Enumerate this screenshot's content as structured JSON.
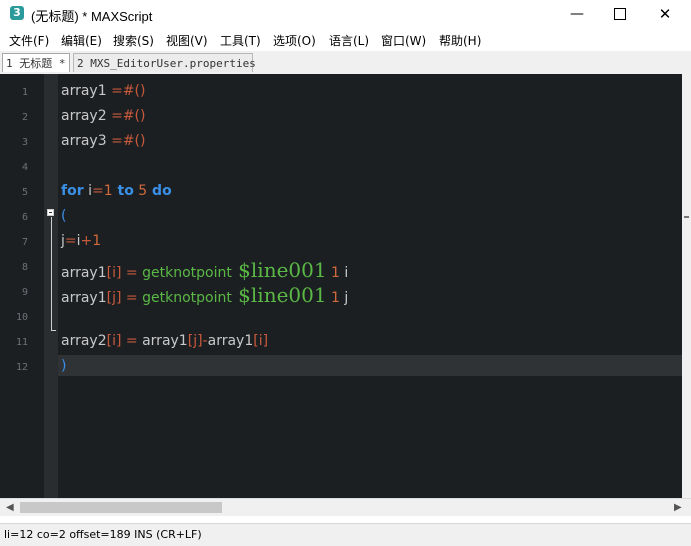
{
  "window": {
    "app_icon": "3",
    "title": "(无标题) * MAXScript",
    "minimize_glyph": "—",
    "close_glyph": "✕"
  },
  "menu": [
    "文件(F)",
    "编辑(E)",
    "搜索(S)",
    "视图(V)",
    "工具(T)",
    "选项(O)",
    "语言(L)",
    "窗口(W)",
    "帮助(H)"
  ],
  "tabs": [
    {
      "label": "1 无标题 *",
      "active": true
    },
    {
      "label": "2 MXS_EditorUser.properties",
      "active": false
    }
  ],
  "line_numbers": [
    "1",
    "2",
    "3",
    "4",
    "5",
    "6",
    "7",
    "8",
    "9",
    "10",
    "11",
    "12"
  ],
  "code": {
    "l1": [
      "array1",
      " =#()"
    ],
    "l2": [
      "array2",
      " =#()"
    ],
    "l3": [
      "array3",
      " =#()"
    ],
    "l5": [
      "for",
      " i",
      "=",
      "1",
      " to",
      " 5",
      " do"
    ],
    "l6": [
      "("
    ],
    "l7": [
      "j",
      "=",
      "i",
      "+",
      "1"
    ],
    "l8": [
      "array1",
      "[",
      "i",
      "]",
      " = ",
      "getknotpoint",
      " $line001",
      " 1",
      " i"
    ],
    "l9": [
      "array1",
      "[",
      "j",
      "]",
      " = ",
      "getknotpoint",
      " $line001",
      " 1",
      " j"
    ],
    "l11": [
      "array2",
      "[",
      "i",
      "]",
      " = ",
      "array1",
      "[",
      "j",
      "]",
      "-",
      "array1",
      "[",
      "i",
      "]"
    ],
    "l12": [
      ")"
    ]
  },
  "scrollbar": {
    "left_arrow": "◀",
    "right_arrow": "▶"
  },
  "status": "li=12 co=2 offset=189 INS (CR+LF)",
  "colors": {
    "editor_bg": "#1c1f22",
    "keyword": "#3a8fe6",
    "function": "#5ab845",
    "operator": "#c85a3c"
  }
}
